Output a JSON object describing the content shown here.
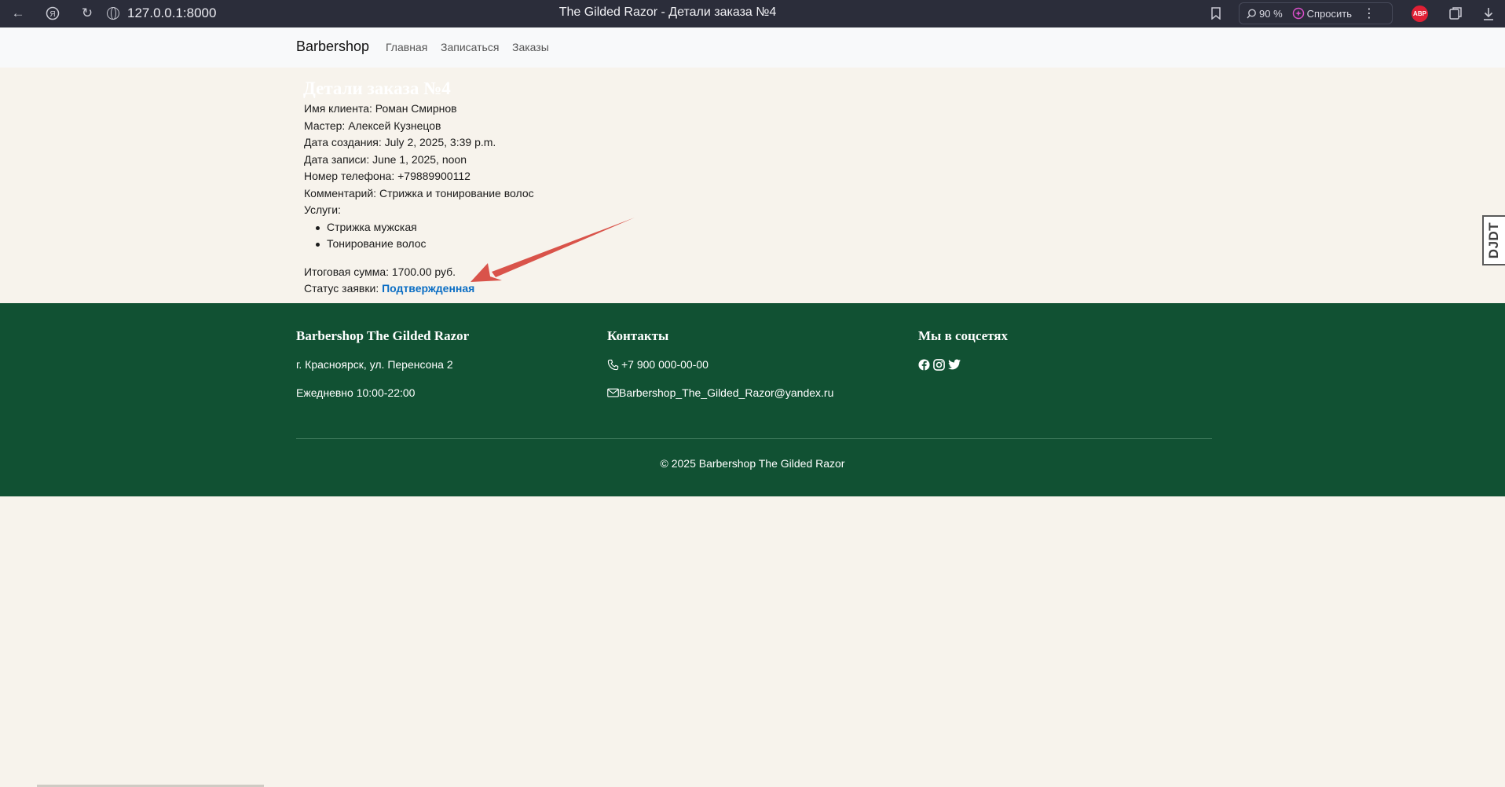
{
  "browser": {
    "url": "127.0.0.1:8000",
    "tab_title": "The Gilded Razor - Детали заказа №4",
    "zoom": "90 %",
    "ask_label": "Спросить",
    "adblock_label": "ABP"
  },
  "nav": {
    "brand": "Barbershop",
    "links": [
      "Главная",
      "Записаться",
      "Заказы"
    ]
  },
  "order": {
    "title": "Детали заказа №4",
    "client": "Имя клиента: Роман Смирнов",
    "master": "Мастер: Алексей Кузнецов",
    "created": "Дата создания: July 2, 2025, 3:39 p.m.",
    "appointment": "Дата записи: June 1, 2025, noon",
    "phone": "Номер телефона: +79889900112",
    "comment": "Комментарий: Стрижка и тонирование волос",
    "services_label": "Услуги:",
    "services": [
      "Стрижка мужская",
      "Тонирование волос"
    ],
    "total": "Итоговая сумма: 1700.00 руб.",
    "status_label": "Статус заявки: ",
    "status_value": "Подтвержденная"
  },
  "footer": {
    "col1_title": "Barbershop The Gilded Razor",
    "address": "г. Красноярск, ул. Перенсона 2",
    "hours": "Ежедневно 10:00-22:00",
    "col2_title": "Контакты",
    "phone": "+7 900 000-00-00",
    "email": "Barbershop_The_Gilded_Razor@yandex.ru",
    "col3_title": "Мы в соцсетях",
    "social_icons": [
      "facebook-icon",
      "instagram-icon",
      "twitter-icon"
    ],
    "copyright": "© 2025 Barbershop The Gilded Razor"
  },
  "debug_toolbar": {
    "label": "DJDT"
  },
  "colors": {
    "page_bg": "#f7f3ec",
    "footer_bg": "#115133",
    "status": "#0b6ec4",
    "annotation_arrow": "#d9534a"
  }
}
